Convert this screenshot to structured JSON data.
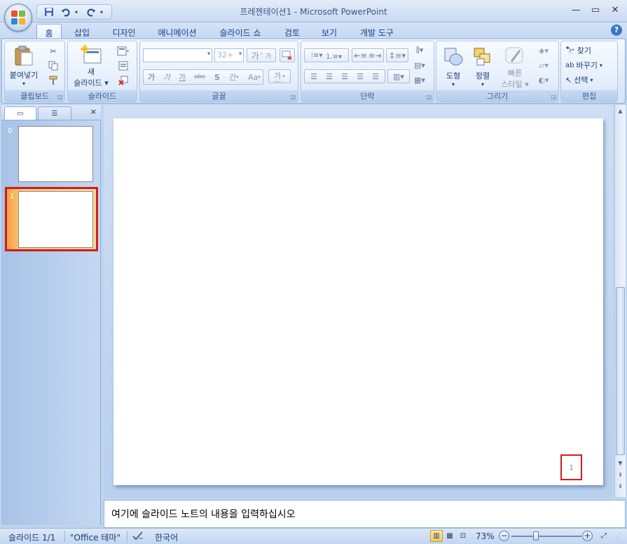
{
  "window": {
    "title": "프레젠테이션1 - Microsoft PowerPoint",
    "controls": [
      "minimize",
      "maximize",
      "close"
    ]
  },
  "quick_access": [
    "save-icon",
    "undo-icon",
    "redo-icon",
    "customize-icon"
  ],
  "tabs": [
    "홈",
    "삽입",
    "디자인",
    "애니메이션",
    "슬라이드 쇼",
    "검토",
    "보기",
    "개발 도구"
  ],
  "active_tab": "홈",
  "ribbon": {
    "clipboard": {
      "label": "클립보드",
      "paste": "붙여넣기"
    },
    "slides": {
      "label": "슬라이드",
      "new_slide_line1": "새",
      "new_slide_line2": "슬라이드"
    },
    "font": {
      "label": "글꼴",
      "font_name": "",
      "font_size": "32+",
      "grow": "가",
      "shrink": "가",
      "bold": "가",
      "italic": "가",
      "underline": "가",
      "strike": "abc",
      "shadow": "S",
      "spacing": "간",
      "case": "Aa",
      "color": "가"
    },
    "paragraph": {
      "label": "단락"
    },
    "drawing": {
      "label": "그리기",
      "shapes": "도형",
      "arrange": "정렬",
      "quick_styles_line1": "빠른",
      "quick_styles_line2": "스타일"
    },
    "editing": {
      "label": "편집",
      "find": "찾기",
      "replace": "바꾸기",
      "select": "선택"
    }
  },
  "slide_panel": {
    "tabs": [
      "slides-tab",
      "outline-tab"
    ],
    "thumbnails": [
      {
        "number": "0",
        "selected": false
      },
      {
        "number": "1",
        "selected": true
      }
    ]
  },
  "slide": {
    "number_placeholder": "1"
  },
  "notes": {
    "placeholder": "여기에 슬라이드 노트의 내용을 입력하십시오"
  },
  "status": {
    "slide_info": "슬라이드 1/1",
    "theme": "\"Office 테마\"",
    "language": "한국어",
    "zoom": "73%",
    "zoom_level": 0.73
  },
  "colors": {
    "selected_outline": "#d41c1c",
    "ribbon_text": "#15428b",
    "active_thumb_bar": "#f59a2f"
  }
}
